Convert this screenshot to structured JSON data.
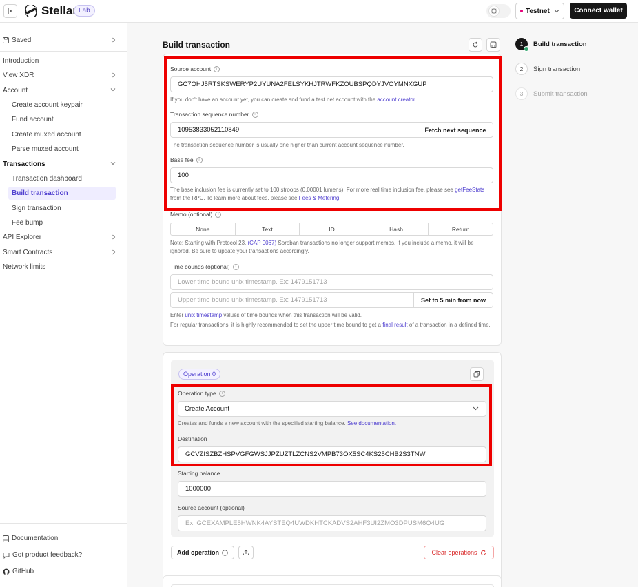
{
  "header": {
    "brand": "Stellar",
    "badge": "Lab",
    "network": "Testnet",
    "connect_label": "Connect wallet"
  },
  "sidebar": {
    "saved": "Saved",
    "introduction": "Introduction",
    "view_xdr": "View XDR",
    "account": "Account",
    "account_items": [
      "Create account keypair",
      "Fund account",
      "Create muxed account",
      "Parse muxed account"
    ],
    "transactions": "Transactions",
    "transaction_items": [
      "Transaction dashboard",
      "Build transaction",
      "Sign transaction",
      "Fee bump"
    ],
    "api_explorer": "API Explorer",
    "smart_contracts": "Smart Contracts",
    "network_limits": "Network limits",
    "documentation": "Documentation",
    "feedback": "Got product feedback?",
    "github": "GitHub"
  },
  "main": {
    "title": "Build transaction",
    "source_account": {
      "label": "Source account",
      "value": "GC7QHJ5RTSKSWERYP2UYUNA2FELSYKHJTRWFKZOUBSPQDYJVOYMNXGUP",
      "help_prefix": "If you don't have an account yet, you can create and fund a test net account with the",
      "help_link": "account creator",
      "help_suffix": "."
    },
    "sequence": {
      "label": "Transaction sequence number",
      "value": "10953833052110849",
      "button": "Fetch next sequence",
      "help": "The transaction sequence number is usually one higher than current account sequence number."
    },
    "base_fee": {
      "label": "Base fee",
      "value": "100",
      "help_line1": "The base inclusion fee is currently set to 100 stroops (0.00001 lumens). For more real time inclusion fee, please see",
      "help_link1": "getFeeStats",
      "help_mid": "from the RPC. To learn more about fees, please see",
      "help_link2": "Fees & Metering",
      "help_end": "."
    },
    "memo": {
      "label": "Memo (optional)",
      "options": [
        "None",
        "Text",
        "ID",
        "Hash",
        "Return"
      ],
      "note_prefix": "Note: Starting with Protocol 23,",
      "note_link": "(CAP 0067)",
      "note_suffix": "Soroban transactions no longer support memos. If you include a memo, it will be ignored. Be sure to update your transactions accordingly."
    },
    "time_bounds": {
      "label": "Time bounds (optional)",
      "lower_placeholder": "Lower time bound unix timestamp. Ex: 1479151713",
      "upper_placeholder": "Upper time bound unix timestamp. Ex: 1479151713",
      "button": "Set to 5 min from now",
      "help1_prefix": "Enter",
      "help1_link": "unix timestamp",
      "help1_suffix": "values of time bounds when this transaction will be valid.",
      "help2_prefix": "For regular transactions, it is highly recommended to set the upper time bound to get a",
      "help2_link": "final result",
      "help2_suffix": "of a transaction in a defined time."
    },
    "operation": {
      "badge": "Operation 0",
      "type_label": "Operation type",
      "type_value": "Create Account",
      "type_help_prefix": "Creates and funds a new account with the specified starting balance.",
      "type_help_link": "See documentation.",
      "destination_label": "Destination",
      "destination_value": "GCVZISZBZHSPVGFGWSJJPZUZTLZCNS2VMPB73OX5SC4KS25CHB2S3TNW",
      "balance_label": "Starting balance",
      "balance_value": "1000000",
      "source_label": "Source account (optional)",
      "source_placeholder": "Ex: GCEXAMPLE5HWNK4AYSTEQ4UWDKHTCKADVS2AHF3UI2ZMO3DPUSM6Q4UG"
    },
    "add_operation": "Add operation",
    "clear_operations": "Clear operations"
  },
  "steps": [
    {
      "num": "1",
      "label": "Build transaction"
    },
    {
      "num": "2",
      "label": "Sign transaction"
    },
    {
      "num": "3",
      "label": "Submit transaction"
    }
  ],
  "colors": {
    "accent": "#4f3fcf",
    "highlight": "#ee0000",
    "danger": "#d92b2b"
  }
}
